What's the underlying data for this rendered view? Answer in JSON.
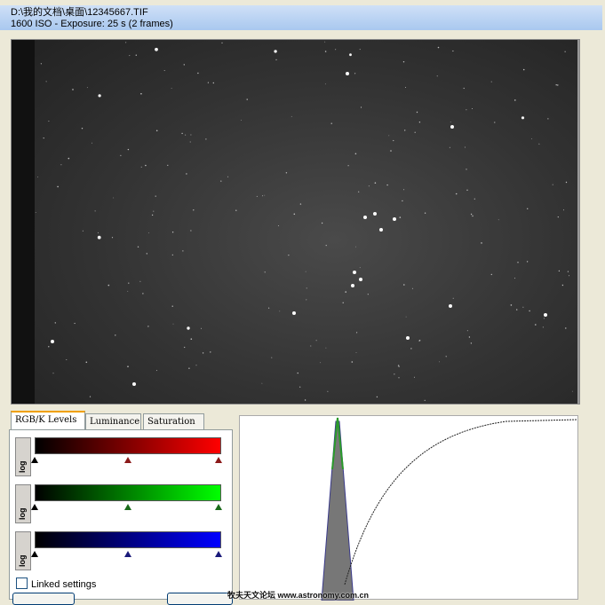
{
  "header": {
    "file_path": "D:\\我的文档\\桌面\\12345667.TIF",
    "exposure_info": "1600 ISO - Exposure: 25 s (2 frames)"
  },
  "tabs": [
    {
      "label": "RGB/K Levels",
      "active": true
    },
    {
      "label": "Luminance",
      "active": false
    },
    {
      "label": "Saturation",
      "active": false
    }
  ],
  "channels": [
    {
      "name": "red",
      "log_label": "log",
      "color": "#ff0000",
      "marker_color": "#8b1a1a",
      "black": 0.0,
      "mid": 0.5,
      "white": 1.0
    },
    {
      "name": "green",
      "log_label": "log",
      "color": "#00ff00",
      "marker_color": "#1a6b1a",
      "black": 0.0,
      "mid": 0.5,
      "white": 1.0
    },
    {
      "name": "blue",
      "log_label": "log",
      "color": "#0000ff",
      "marker_color": "#1a1a7a",
      "black": 0.0,
      "mid": 0.5,
      "white": 1.0
    }
  ],
  "linked_settings": {
    "label": "Linked settings",
    "checked": false
  },
  "watermark": "牧夫天文论坛 www.astronomy.com.cn"
}
